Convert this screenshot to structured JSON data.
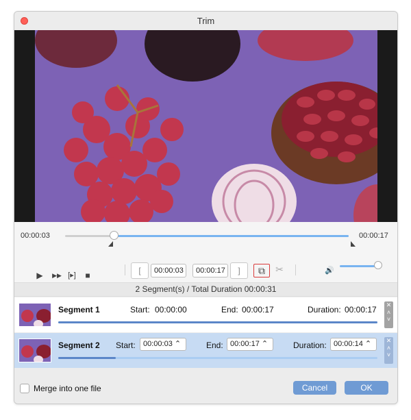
{
  "window": {
    "title": "Trim"
  },
  "timeline": {
    "start_time": "00:00:03",
    "end_time": "00:00:17",
    "progress": 0.17
  },
  "controls": {
    "play": "▶",
    "fast_forward": "▶▶",
    "step": "[▸]",
    "stop": "■",
    "set_start_bracket": "[",
    "start_time": "00:00:03",
    "end_time": "00:00:17",
    "set_end_bracket": "]",
    "add_segment_icon": "⧉",
    "split_icon": "✂",
    "volume_icon": "🔊"
  },
  "summary": {
    "text": "2 Segment(s) / Total Duration 00:00:31"
  },
  "segments": [
    {
      "name": "Segment 1",
      "start_label": "Start:",
      "start": "00:00:00",
      "end_label": "End:",
      "end": "00:00:17",
      "duration_label": "Duration:",
      "duration": "00:00:17",
      "range_fraction": 1.0
    },
    {
      "name": "Segment 2",
      "start_label": "Start:",
      "start": "00:00:03",
      "end_label": "End:",
      "end": "00:00:17",
      "duration_label": "Duration:",
      "duration": "00:00:14",
      "range_fraction": 0.18
    }
  ],
  "footer": {
    "merge_label": "Merge into one file",
    "cancel": "Cancel",
    "ok": "OK"
  },
  "colors": {
    "accent": "#6f9bd4",
    "timeline_fill": "#78b4f0",
    "selected_row": "#c7dbf3",
    "close_button": "#ff5f57"
  }
}
